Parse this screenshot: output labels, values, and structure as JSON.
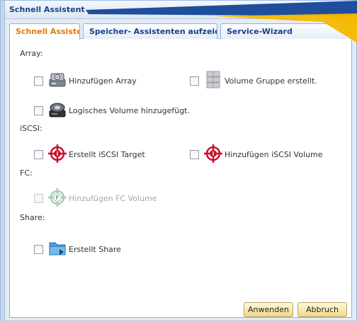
{
  "window": {
    "title": "Schnell Assistent",
    "close_label": "[x]"
  },
  "tabs": [
    {
      "label": "Schnell Assistent"
    },
    {
      "label": "Speicher- Assistenten aufzeichnen"
    },
    {
      "label": "Service-Wizard"
    }
  ],
  "sections": {
    "array": "Array:",
    "iscsi": "iSCSI:",
    "fc": "FC:",
    "share": "Share:"
  },
  "items": {
    "add_array": "Hinzufügen Array",
    "volume_group": "Volume Gruppe erstellt.",
    "logical_volume": "Logisches Volume hinzugefügt.",
    "iscsi_target": "Erstellt iSCSI Target",
    "iscsi_volume": "Hinzufügen iSCSI Volume",
    "fc_volume": "Hinzufügen FC Volume",
    "create_share": "Erstellt Share"
  },
  "buttons": {
    "apply": "Anwenden",
    "cancel": "Abbruch"
  },
  "colors": {
    "active_tab_text": "#e07b00",
    "tab_text": "#15428b",
    "arrow_yellow": "#f5b800",
    "arrow_blue": "#1f4e9c"
  },
  "icons": {
    "add_array": "hard-disk-icon",
    "volume_group": "server-stack-icon",
    "logical_volume": "disk-drive-icon",
    "iscsi_target": "target-icon",
    "iscsi_volume": "target-icon",
    "fc_volume": "fc-icon",
    "create_share": "folder-share-icon"
  }
}
